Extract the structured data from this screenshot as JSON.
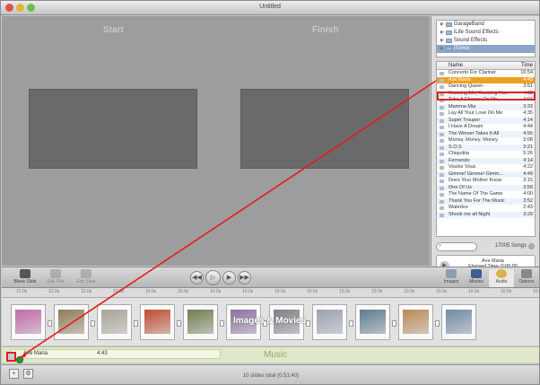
{
  "window": {
    "title": "Untitled"
  },
  "preview": {
    "start_label": "Start",
    "finish_label": "Finish"
  },
  "sources": [
    {
      "label": "GarageBand",
      "selected": false
    },
    {
      "label": "iLife Sound Effects",
      "selected": false
    },
    {
      "label": "Sound Effects",
      "selected": false
    },
    {
      "label": "iTunes",
      "selected": true
    }
  ],
  "songs": {
    "headers": {
      "name": "Name",
      "time": "Time"
    },
    "rows": [
      {
        "name": "Concerto For Clarinet",
        "time": "16:54"
      },
      {
        "name": "Ave Maria",
        "time": "4:43"
      },
      {
        "name": "Dancing Queen",
        "time": "3:51"
      },
      {
        "name": "Knowing Me, Knowing You",
        "time": "4:02"
      },
      {
        "name": "Take A Chance On Me",
        "time": "4:04"
      },
      {
        "name": "Mamma Mia",
        "time": "3:33"
      },
      {
        "name": "Lay All Your Love On Me",
        "time": "4:35"
      },
      {
        "name": "Super Trouper",
        "time": "4:14"
      },
      {
        "name": "I Have A Dream",
        "time": "4:44"
      },
      {
        "name": "The Winner Takes It All",
        "time": "4:56"
      },
      {
        "name": "Money, Money, Money",
        "time": "3:08"
      },
      {
        "name": "S.O.S",
        "time": "3:21"
      },
      {
        "name": "Chiquitita",
        "time": "5:26"
      },
      {
        "name": "Fernando",
        "time": "4:14"
      },
      {
        "name": "Voulez Vous",
        "time": "4:22"
      },
      {
        "name": "Gimme! Gimme! Gimm...",
        "time": "4:49"
      },
      {
        "name": "Does Your Mother Know",
        "time": "3:15"
      },
      {
        "name": "One Of Us",
        "time": "3:58"
      },
      {
        "name": "The Name Of The Game",
        "time": "4:00"
      },
      {
        "name": "Thank You For The Music",
        "time": "3:52"
      },
      {
        "name": "Waterloo",
        "time": "2:43"
      },
      {
        "name": "Shook me all Night",
        "time": "3:29"
      }
    ],
    "highlighted_index": 1,
    "count_label": "17005 Songs"
  },
  "player": {
    "song": "Ave Maria",
    "elapsed": "Elapsed Time: 0:00:00"
  },
  "toolbar": {
    "blank_slide": "Blank Slide",
    "edit_title": "Edit Title",
    "edit_slide": "Edit Slide",
    "prev_icon": "◀◀",
    "play_icon": "▷",
    "play_fill_icon": "▶",
    "next_icon": "▶▶",
    "images": "Images",
    "movies": "Movies",
    "audio": "Audio",
    "options": "Options"
  },
  "ruler_labels": [
    "10.0s",
    "10.0s",
    "10.0s",
    "10.0s",
    "10.0s",
    "10.0s",
    "10.0s",
    "10.0s",
    "10.0s",
    "10.0s",
    "10.0s",
    "10.0s",
    "10.0s",
    "10.0s",
    "10.0s",
    "10.0s",
    "10.0s"
  ],
  "track": {
    "label": "Images & Movies",
    "slides": [
      {
        "color": "#c26aa8"
      },
      {
        "color": "#8f7b57"
      },
      {
        "color": "#a8a598"
      },
      {
        "color": "#c04c2e"
      },
      {
        "color": "#6d7d4f"
      },
      {
        "color": "#8c6fa0"
      },
      {
        "color": "#7d7f86"
      },
      {
        "color": "#9aa3b0"
      },
      {
        "color": "#5f7b8f"
      },
      {
        "color": "#b98a55"
      },
      {
        "color": "#6e8aa4"
      }
    ]
  },
  "music": {
    "name": "Ave Maria",
    "duration": "4:43",
    "label": "Music"
  },
  "bottom": {
    "add": "+",
    "settings": "⚙",
    "status": "10 slides total (0:51:40)"
  },
  "colors": {
    "highlight_red": "#e0201c",
    "selection_orange": "#f0a020",
    "close": "#e05246",
    "minimize": "#e4b43a",
    "zoom": "#6bc04a"
  }
}
